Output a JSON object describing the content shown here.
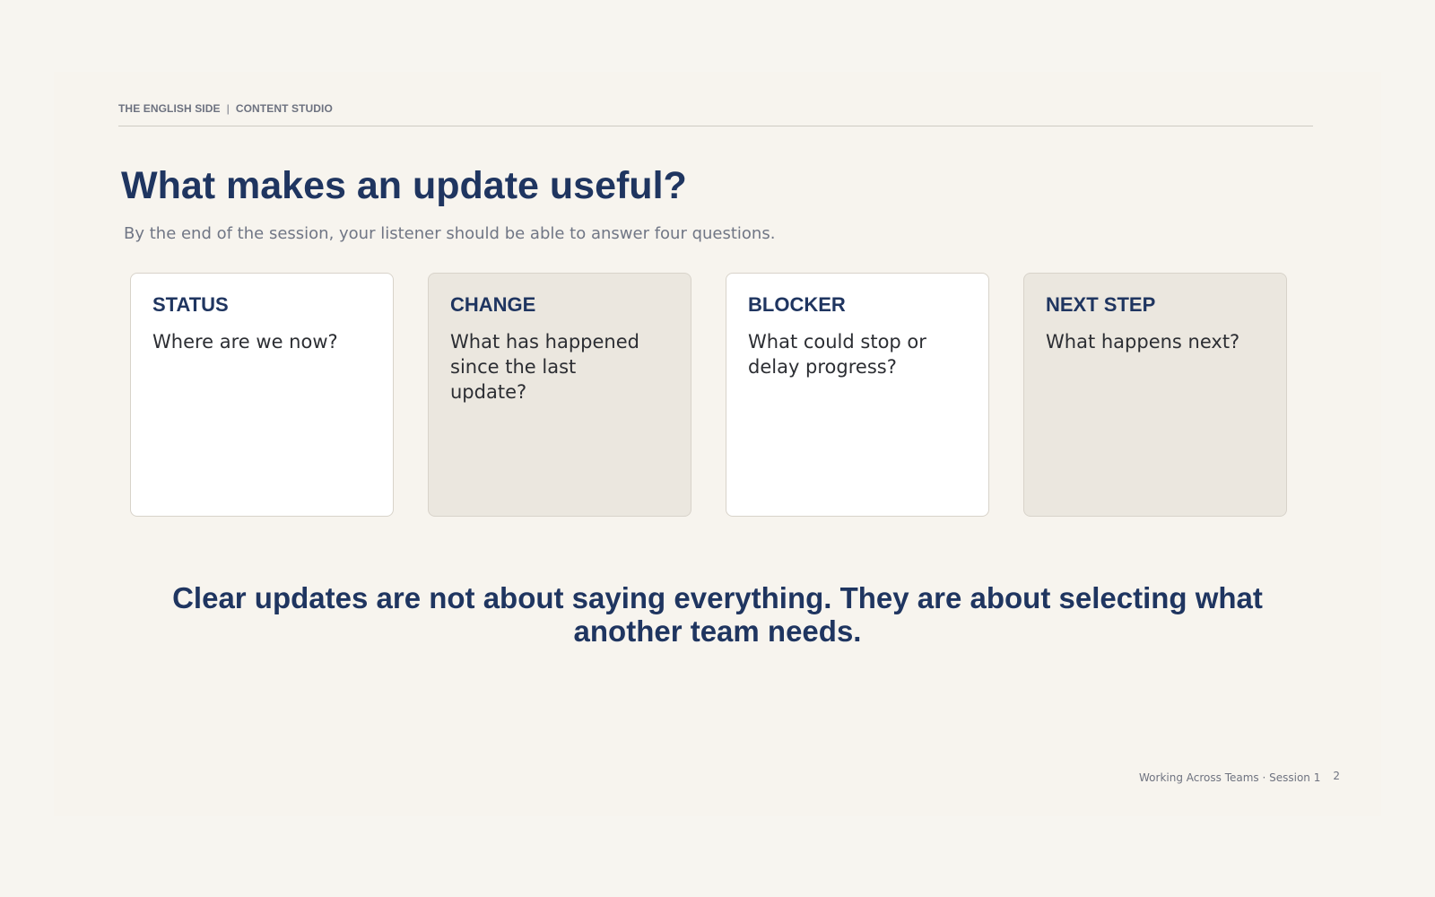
{
  "header": {
    "brand": "THE ENGLISH SIDE",
    "separator": "|",
    "section": "CONTENT STUDIO"
  },
  "title": "What makes an update useful?",
  "subtitle": "By the end of the session, your listener should be able to answer four questions.",
  "cards": [
    {
      "label": "STATUS",
      "text": "Where are we now?"
    },
    {
      "label": "CHANGE",
      "text": "What has happened since the last update?"
    },
    {
      "label": "BLOCKER",
      "text": "What could stop or delay progress?"
    },
    {
      "label": "NEXT STEP",
      "text": "What happens next?"
    }
  ],
  "takeaway": "Clear updates are not about saying everything. They are about selecting what another team needs.",
  "footer": {
    "course": "Working Across Teams · Session 1",
    "page_number": "2"
  },
  "colors": {
    "background": "#f7f5f0",
    "navy": "#1f3560",
    "card_white": "#ffffff",
    "card_tinted": "#ebe7df"
  }
}
